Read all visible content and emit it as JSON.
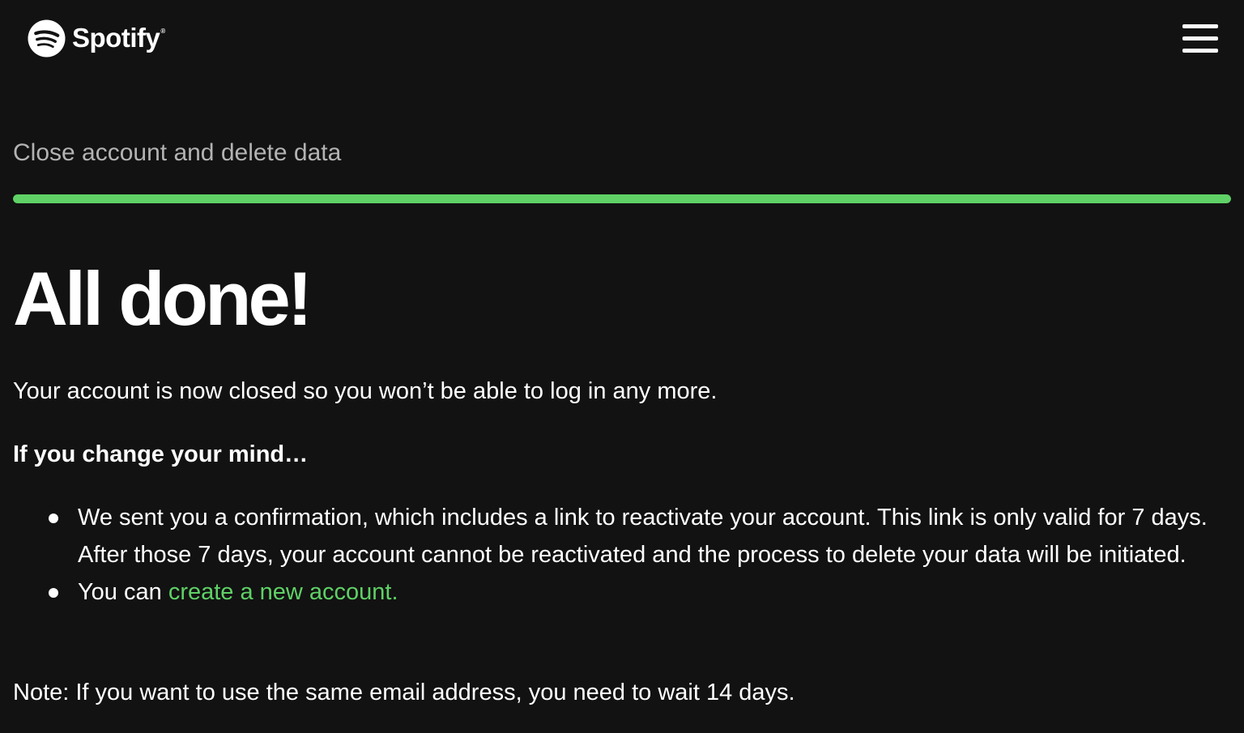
{
  "header": {
    "brand": "Spotify",
    "brand_mark": "®",
    "logo_icon": "spotify-logo-icon",
    "menu_icon": "hamburger-menu-icon"
  },
  "step": {
    "title": "Close account and delete data",
    "progress_percent": 100,
    "progress_color": "#5fd166"
  },
  "main": {
    "headline": "All done!",
    "message": "Your account is now closed so you won’t be able to log in any more.",
    "change_mind_heading": "If you change your mind…",
    "bullets": [
      {
        "text": "We sent you a confirmation, which includes a link to reactivate your account. This link is only valid for 7 days. After those 7 days, your account cannot be reactivated and the process to delete your data will be initiated."
      },
      {
        "prefix": "You can ",
        "link_text": "create a new account."
      }
    ],
    "note": "Note: If you want to use the same email address, you need to wait 14 days."
  },
  "colors": {
    "background": "#121212",
    "accent": "#5fd166",
    "muted_text": "#b3b3b3"
  }
}
